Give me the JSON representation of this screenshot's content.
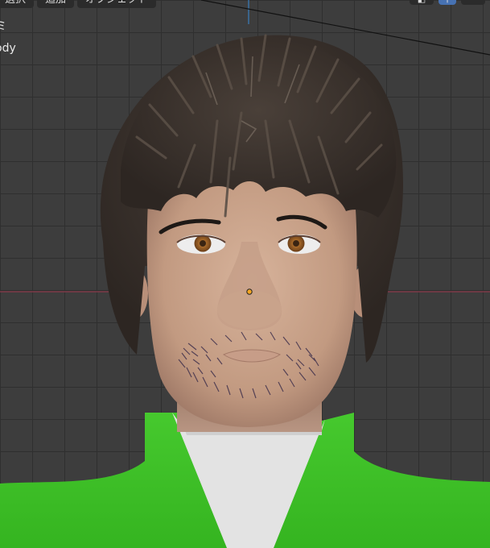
{
  "header": {
    "menu": [
      {
        "label": "選択"
      },
      {
        "label": "追加"
      },
      {
        "label": "オブジェクト"
      }
    ]
  },
  "overlay": {
    "line1": "ミ",
    "line2": "ody"
  },
  "colors": {
    "viewport_bg": "#3d3d3d",
    "grid_line": "#2f2f2f",
    "x_axis": "#8a3a4a",
    "z_axis": "#3a7fbf",
    "origin_dot": "#f5a623",
    "shirt_green": "#3fc229",
    "collar_white": "#e4e4e4",
    "skin": "#c8a28a",
    "hair": "#3b332e"
  }
}
